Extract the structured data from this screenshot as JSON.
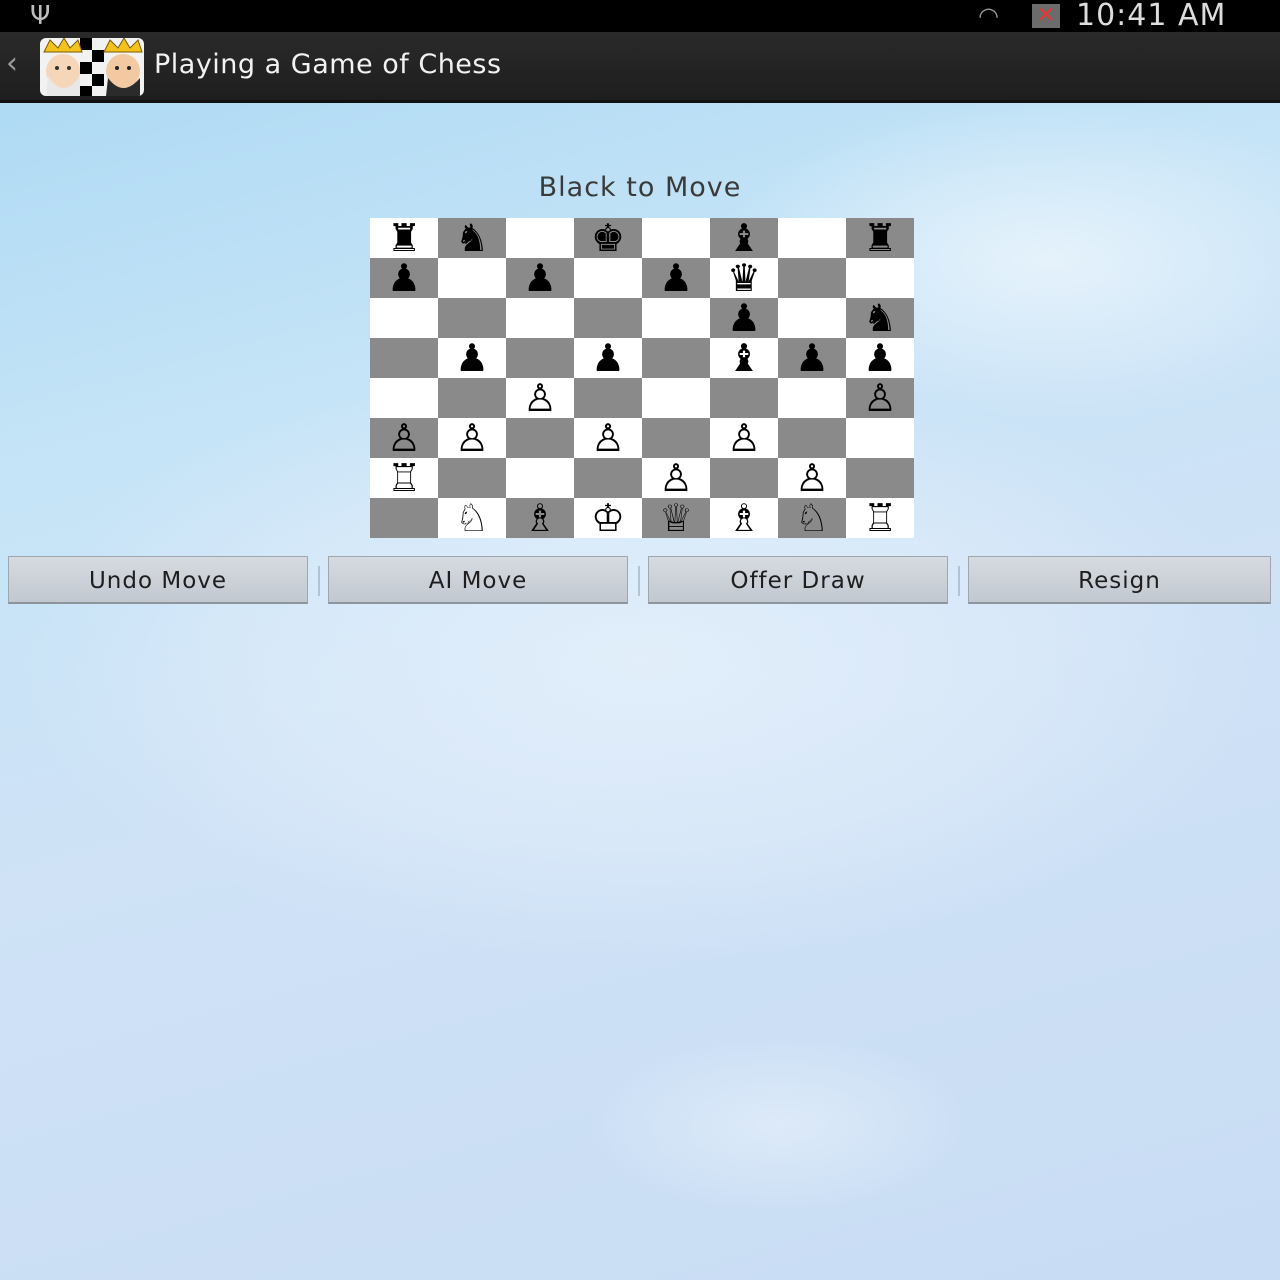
{
  "status_bar": {
    "usb_icon": "usb-icon",
    "wifi_icon": "wifi-icon",
    "sim_icon": "no-sim-icon",
    "time": "10:41 AM"
  },
  "action_bar": {
    "back_icon": "back-caret-icon",
    "app_icon": "chess-kings-app-icon",
    "title": "Playing a Game of Chess"
  },
  "game": {
    "turn_text": "Black to Move",
    "board": [
      [
        "br",
        "bn",
        "",
        "bk",
        "",
        "bb",
        "",
        "br"
      ],
      [
        "bp",
        "",
        "bp",
        "",
        "bp",
        "bq",
        "",
        ""
      ],
      [
        "",
        "",
        "",
        "",
        "",
        "bp",
        "",
        "bn"
      ],
      [
        "",
        "bp",
        "",
        "bp",
        "",
        "bb",
        "bp",
        "bp"
      ],
      [
        "",
        "",
        "wp",
        "",
        "",
        "",
        "",
        "wp"
      ],
      [
        "wp",
        "wp",
        "",
        "wp",
        "",
        "wp",
        "",
        ""
      ],
      [
        "wr",
        "",
        "",
        "",
        "wp",
        "",
        "wp",
        ""
      ],
      [
        "",
        "wn",
        "wb",
        "wk",
        "wq",
        "wb",
        "wn",
        "wr"
      ]
    ]
  },
  "buttons": {
    "undo": "Undo Move",
    "ai": "AI Move",
    "draw": "Offer Draw",
    "resign": "Resign"
  },
  "colors": {
    "light_square": "#ffffff",
    "dark_square": "#8a8a8a",
    "action_bar": "#222222"
  }
}
